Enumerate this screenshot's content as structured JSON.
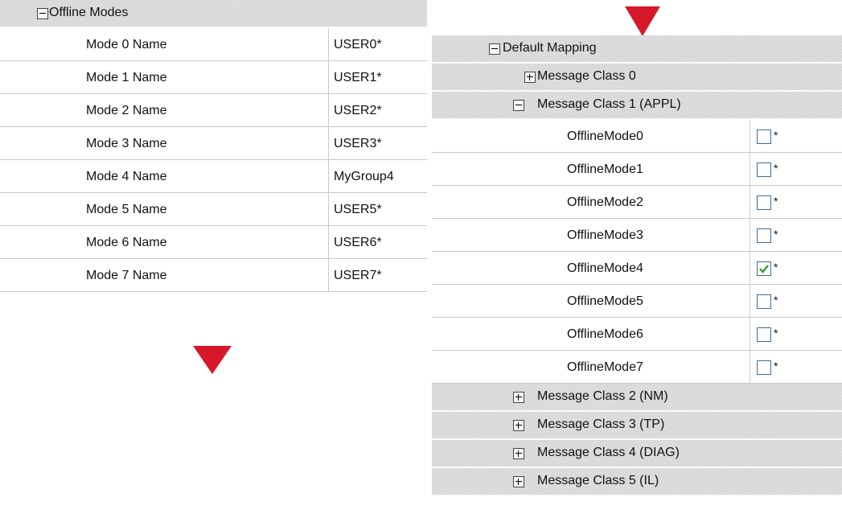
{
  "offline_modes": {
    "header_label": "Offline Modes",
    "rows": [
      {
        "name": "Mode 0 Name",
        "value": "USER0*"
      },
      {
        "name": "Mode 1 Name",
        "value": "USER1*"
      },
      {
        "name": "Mode 2 Name",
        "value": "USER2*"
      },
      {
        "name": "Mode 3 Name",
        "value": "USER3*"
      },
      {
        "name": "Mode 4 Name",
        "value": "MyGroup4"
      },
      {
        "name": "Mode 5 Name",
        "value": "USER5*"
      },
      {
        "name": "Mode 6 Name",
        "value": "USER6*"
      },
      {
        "name": "Mode 7 Name",
        "value": "USER7*"
      }
    ]
  },
  "default_mapping": {
    "header_label": "Default Mapping",
    "class0_label": "Message Class 0",
    "class1_label": "Message Class 1 (APPL)",
    "modes": [
      {
        "name": "OfflineMode0",
        "checked": false,
        "suffix": "*"
      },
      {
        "name": "OfflineMode1",
        "checked": false,
        "suffix": "*"
      },
      {
        "name": "OfflineMode2",
        "checked": false,
        "suffix": "*"
      },
      {
        "name": "OfflineMode3",
        "checked": false,
        "suffix": "*"
      },
      {
        "name": "OfflineMode4",
        "checked": true,
        "suffix": "*"
      },
      {
        "name": "OfflineMode5",
        "checked": false,
        "suffix": "*"
      },
      {
        "name": "OfflineMode6",
        "checked": false,
        "suffix": "*"
      },
      {
        "name": "OfflineMode7",
        "checked": false,
        "suffix": "*"
      }
    ],
    "class2_label": "Message Class 2 (NM)",
    "class3_label": "Message Class 3 (TP)",
    "class4_label": "Message Class 4 (DIAG)",
    "class5_label": "Message Class 5 (IL)"
  },
  "colors": {
    "header_bg": "#dcdcdc",
    "grid_line": "#c9c9c9",
    "arrow_marker": "#d7182a",
    "checkbox_border": "#3b6e9c",
    "check_mark": "#2e9d2e"
  },
  "icons": {
    "expanded_toggle": "minus-box-icon",
    "collapsed_toggle": "plus-box-icon",
    "arrow_marker": "down-triangle-icon",
    "check_mark": "checkmark-icon"
  }
}
